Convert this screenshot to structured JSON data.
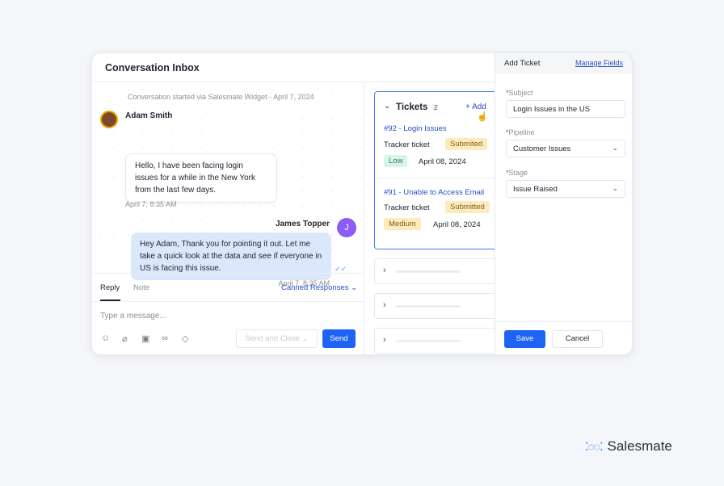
{
  "header": {
    "title": "Conversation Inbox"
  },
  "chat": {
    "started": "Conversation started via Salesmate Widget - April 7, 2024",
    "messages": [
      {
        "sender": "Adam Smith",
        "text": "Hello, I have been facing login issues for a while in the New York from the last few days.",
        "time": "April 7, 8:35 AM"
      },
      {
        "sender": "James Topper",
        "avatar": "J",
        "text": "Hey Adam, Thank you for pointing it out. Let me take a quick look at the data and see if everyone in US is facing this issue.",
        "time": "April 7, 8:35 AM"
      }
    ]
  },
  "reply": {
    "tabs": [
      "Reply",
      "Note"
    ],
    "canned": "Canned Responses",
    "placeholder": "Type a message...",
    "send_close": "Send and Close",
    "send": "Send",
    "icons": [
      "emoji-icon",
      "attachment-icon",
      "image-icon",
      "link-icon",
      "ticket-icon"
    ]
  },
  "tickets": {
    "title": "Tickets",
    "count": "2",
    "add": "Add",
    "items": [
      {
        "title": "#92 - Login Issues",
        "type": "Tracker ticket",
        "status": "Submited",
        "priority": "Low",
        "date": "April 08, 2024"
      },
      {
        "title": "#91 - Unable to Access Email",
        "type": "Tracker ticket",
        "status": "Submitted",
        "priority": "Medium",
        "date": "April 08, 2024"
      }
    ]
  },
  "add_ticket": {
    "title": "Add Ticket",
    "manage": "Manage Fields",
    "subject_label": "Subject",
    "subject": "Login Issues in the US",
    "pipeline_label": "Pipeline",
    "pipeline": "Customer Issues",
    "stage_label": "Stage",
    "stage": "Issue Raised",
    "save": "Save",
    "cancel": "Cancel"
  },
  "brand": {
    "name": "Salesmate"
  },
  "colors": {
    "accent": "#1f63f5",
    "purple": "#8b5cf6",
    "low": "#d8f5ea",
    "medium": "#fdebc0"
  }
}
